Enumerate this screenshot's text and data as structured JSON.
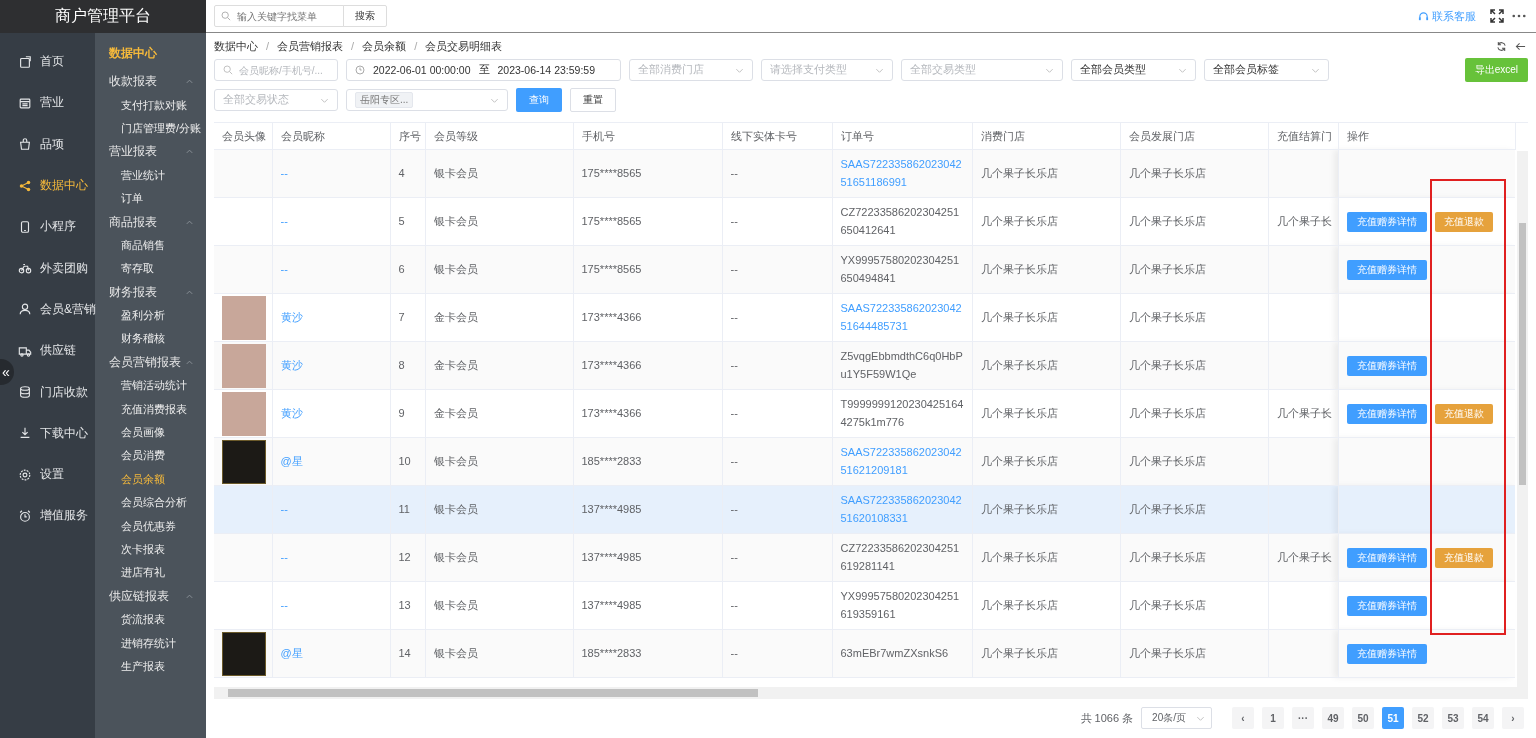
{
  "brand": "商户管理平台",
  "nav": [
    {
      "label": "首页",
      "selected": false
    },
    {
      "label": "营业",
      "selected": false
    },
    {
      "label": "品项",
      "selected": false
    },
    {
      "label": "数据中心",
      "selected": true
    },
    {
      "label": "小程序",
      "selected": false
    },
    {
      "label": "外卖团购",
      "selected": false
    },
    {
      "label": "会员&营销",
      "selected": false
    },
    {
      "label": "供应链",
      "selected": false
    },
    {
      "label": "门店收款",
      "selected": false
    },
    {
      "label": "下载中心",
      "selected": false
    },
    {
      "label": "设置",
      "selected": false
    },
    {
      "label": "增值服务",
      "selected": false
    }
  ],
  "collapse": "«",
  "submenu": {
    "title": "数据中心",
    "groups": [
      {
        "label": "收款报表",
        "expanded": true,
        "children": [
          {
            "label": "支付打款对账",
            "selected": false
          },
          {
            "label": "门店管理费/分账",
            "selected": false
          }
        ]
      },
      {
        "label": "营业报表",
        "expanded": true,
        "children": [
          {
            "label": "营业统计",
            "selected": false
          },
          {
            "label": "订单",
            "selected": false
          }
        ]
      },
      {
        "label": "商品报表",
        "expanded": true,
        "children": [
          {
            "label": "商品销售",
            "selected": false
          },
          {
            "label": "寄存取",
            "selected": false
          }
        ]
      },
      {
        "label": "财务报表",
        "expanded": true,
        "children": [
          {
            "label": "盈利分析",
            "selected": false
          },
          {
            "label": "财务稽核",
            "selected": false
          }
        ]
      },
      {
        "label": "会员营销报表",
        "expanded": true,
        "children": [
          {
            "label": "营销活动统计",
            "selected": false
          },
          {
            "label": "充值消费报表",
            "selected": false
          },
          {
            "label": "会员画像",
            "selected": false
          },
          {
            "label": "会员消费",
            "selected": false
          },
          {
            "label": "会员余额",
            "selected": true
          },
          {
            "label": "会员综合分析",
            "selected": false
          },
          {
            "label": "会员优惠券",
            "selected": false
          },
          {
            "label": "次卡报表",
            "selected": false
          },
          {
            "label": "进店有礼",
            "selected": false
          }
        ]
      },
      {
        "label": "供应链报表",
        "expanded": true,
        "children": [
          {
            "label": "货流报表",
            "selected": false
          },
          {
            "label": "进销存统计",
            "selected": false
          },
          {
            "label": "生产报表",
            "selected": false
          }
        ]
      }
    ]
  },
  "topbar": {
    "search": {
      "placeholder": "输入关键字找菜单"
    },
    "search_button": "搜索",
    "support": "联系客服"
  },
  "breadcrumb": [
    "数据中心",
    "会员营销报表",
    "会员余额",
    "会员交易明细表"
  ],
  "breadcrumb_separator": "/",
  "filters": [
    {
      "kind": "search",
      "placeholder": "会员昵称/手机号/..."
    },
    {
      "kind": "daterange",
      "start": "2022-06-01 00:00:00",
      "separator": "至",
      "end": "2023-06-14 23:59:59"
    },
    {
      "kind": "select",
      "placeholder": "全部消费门店"
    },
    {
      "kind": "select",
      "placeholder": "请选择支付类型"
    },
    {
      "kind": "select",
      "placeholder": "全部交易类型"
    },
    {
      "kind": "select",
      "value": "全部会员类型"
    },
    {
      "kind": "select",
      "value": "全部会员标签"
    }
  ],
  "export_button": "导出excel",
  "filters2": [
    {
      "kind": "select",
      "placeholder": "全部交易状态"
    },
    {
      "kind": "tags",
      "tags": [
        "岳阳专区..."
      ]
    }
  ],
  "query_button": "查询",
  "reset_button": "重置",
  "columns": [
    "会员头像",
    "会员昵称",
    "序号",
    "会员等级",
    "手机号",
    "线下实体卡号",
    "订单号",
    "消费门店",
    "会员发展门店",
    "充值结算门",
    "操作"
  ],
  "rows": [
    {
      "nickname": "--",
      "seq": "4",
      "level": "银卡会员",
      "phone": "175****8565",
      "card": "--",
      "order": "SAAS72233586202304251651186991",
      "order_link": true,
      "store": "几个果子长乐店",
      "dev_store": "几个果子长乐店",
      "settle_store": "",
      "hovered": false,
      "actions": []
    },
    {
      "nickname": "--",
      "seq": "5",
      "level": "银卡会员",
      "phone": "175****8565",
      "card": "--",
      "order": "CZ72233586202304251650412641",
      "order_link": false,
      "store": "几个果子长乐店",
      "dev_store": "几个果子长乐店",
      "settle_store": "几个果子长",
      "hovered": false,
      "actions": [
        {
          "kind": "detail",
          "label": "充值赠券详情"
        },
        {
          "kind": "refund",
          "label": "充值退款"
        }
      ]
    },
    {
      "nickname": "--",
      "seq": "6",
      "level": "银卡会员",
      "phone": "175****8565",
      "card": "--",
      "order": "YX99957580202304251650494841",
      "order_link": false,
      "store": "几个果子长乐店",
      "dev_store": "几个果子长乐店",
      "settle_store": "",
      "hovered": false,
      "actions": [
        {
          "kind": "detail",
          "label": "充值赠券详情"
        }
      ]
    },
    {
      "avatar": {
        "kind": "photo"
      },
      "nickname": "黄沙",
      "seq": "7",
      "level": "金卡会员",
      "phone": "173****4366",
      "card": "--",
      "order": "SAAS72233586202304251644485731",
      "order_link": true,
      "store": "几个果子长乐店",
      "dev_store": "几个果子长乐店",
      "settle_store": "",
      "hovered": false,
      "actions": []
    },
    {
      "avatar": {
        "kind": "photo"
      },
      "nickname": "黄沙",
      "seq": "8",
      "level": "金卡会员",
      "phone": "173****4366",
      "card": "--",
      "order": "Z5vqgEbbmdthC6q0HbPu1Y5F59W1Qe",
      "order_link": false,
      "store": "几个果子长乐店",
      "dev_store": "几个果子长乐店",
      "settle_store": "",
      "hovered": false,
      "actions": [
        {
          "kind": "detail",
          "label": "充值赠券详情"
        }
      ]
    },
    {
      "avatar": {
        "kind": "photo"
      },
      "nickname": "黄沙",
      "seq": "9",
      "level": "金卡会员",
      "phone": "173****4366",
      "card": "--",
      "order": "T99999991202304251644275k1m776",
      "order_link": false,
      "store": "几个果子长乐店",
      "dev_store": "几个果子长乐店",
      "settle_store": "几个果子长",
      "hovered": false,
      "actions": [
        {
          "kind": "detail",
          "label": "充值赠券详情"
        },
        {
          "kind": "refund",
          "label": "充值退款"
        }
      ]
    },
    {
      "avatar": {
        "kind": "emblem"
      },
      "nickname": "@星",
      "seq": "10",
      "level": "银卡会员",
      "phone": "185****2833",
      "card": "--",
      "order": "SAAS72233586202304251621209181",
      "order_link": true,
      "store": "几个果子长乐店",
      "dev_store": "几个果子长乐店",
      "settle_store": "",
      "hovered": false,
      "actions": []
    },
    {
      "nickname": "--",
      "seq": "11",
      "level": "银卡会员",
      "phone": "137****4985",
      "card": "--",
      "order": "SAAS72233586202304251620108331",
      "order_link": true,
      "store": "几个果子长乐店",
      "dev_store": "几个果子长乐店",
      "settle_store": "",
      "hovered": true,
      "actions": []
    },
    {
      "nickname": "--",
      "seq": "12",
      "level": "银卡会员",
      "phone": "137****4985",
      "card": "--",
      "order": "CZ72233586202304251619281141",
      "order_link": false,
      "store": "几个果子长乐店",
      "dev_store": "几个果子长乐店",
      "settle_store": "几个果子长",
      "hovered": false,
      "actions": [
        {
          "kind": "detail",
          "label": "充值赠券详情"
        },
        {
          "kind": "refund",
          "label": "充值退款"
        }
      ]
    },
    {
      "nickname": "--",
      "seq": "13",
      "level": "银卡会员",
      "phone": "137****4985",
      "card": "--",
      "order": "YX99957580202304251619359161",
      "order_link": false,
      "store": "几个果子长乐店",
      "dev_store": "几个果子长乐店",
      "settle_store": "",
      "hovered": false,
      "actions": [
        {
          "kind": "detail",
          "label": "充值赠券详情"
        }
      ]
    },
    {
      "avatar": {
        "kind": "emblem"
      },
      "nickname": "@星",
      "seq": "14",
      "level": "银卡会员",
      "phone": "185****2833",
      "card": "--",
      "order": "63mEBr7wmZXsnkS6",
      "order_link": false,
      "store": "几个果子长乐店",
      "dev_store": "几个果子长乐店",
      "settle_store": "",
      "hovered": false,
      "actions": [
        {
          "kind": "detail",
          "label": "充值赠券详情"
        }
      ]
    }
  ],
  "pagination": {
    "total": "共 1066 条",
    "page_size": "20条/页",
    "prev": "‹",
    "next": "›",
    "pages": [
      {
        "label": "1",
        "selected": false
      },
      {
        "label": "···",
        "selected": false
      },
      {
        "label": "49",
        "selected": false
      },
      {
        "label": "50",
        "selected": false
      },
      {
        "label": "51",
        "selected": true
      },
      {
        "label": "52",
        "selected": false
      },
      {
        "label": "53",
        "selected": false
      },
      {
        "label": "54",
        "selected": false
      }
    ]
  }
}
